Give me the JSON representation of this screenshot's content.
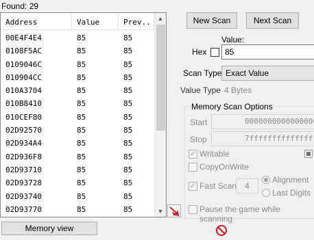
{
  "found": {
    "label": "Found: 29"
  },
  "list": {
    "columns": [
      "Address",
      "Value",
      "Prev.."
    ],
    "rows": [
      {
        "address": "00E4F4E4",
        "value": "85",
        "prev": "85"
      },
      {
        "address": "0108F5AC",
        "value": "85",
        "prev": "85"
      },
      {
        "address": "0109046C",
        "value": "85",
        "prev": "85"
      },
      {
        "address": "010904CC",
        "value": "85",
        "prev": "85"
      },
      {
        "address": "010A3704",
        "value": "85",
        "prev": "85"
      },
      {
        "address": "010B8410",
        "value": "85",
        "prev": "85"
      },
      {
        "address": "010CEF80",
        "value": "85",
        "prev": "85"
      },
      {
        "address": "02D92570",
        "value": "85",
        "prev": "85"
      },
      {
        "address": "02D934A4",
        "value": "85",
        "prev": "85"
      },
      {
        "address": "02D936F8",
        "value": "85",
        "prev": "85"
      },
      {
        "address": "02D93710",
        "value": "85",
        "prev": "85"
      },
      {
        "address": "02D93728",
        "value": "85",
        "prev": "85"
      },
      {
        "address": "02D93740",
        "value": "85",
        "prev": "85"
      },
      {
        "address": "02D93770",
        "value": "85",
        "prev": "85"
      }
    ]
  },
  "buttons": {
    "new_scan": "New Scan",
    "next_scan": "Next Scan",
    "memory_view": "Memory view"
  },
  "value": {
    "label": "Value:",
    "hex_label": "Hex",
    "current": "85"
  },
  "scan_type": {
    "label": "Scan Type",
    "selected": "Exact Value"
  },
  "value_type": {
    "label": "Value Type",
    "selected": "4 Bytes"
  },
  "memory_scan_options": {
    "title": "Memory Scan Options",
    "start_label": "Start",
    "start_value": "0000000000000000",
    "stop_label": "Stop",
    "stop_value": "7fffffffffffffff",
    "writable": "Writable",
    "copy_on_write": "CopyOnWrite",
    "fast_scan": "Fast Scan",
    "fast_scan_value": "4",
    "alignment": "Alignment",
    "last_digits": "Last Digits",
    "pause_game": "Pause the game while scanning"
  },
  "colors": {
    "stop_icon": "#d0191d",
    "pointer_arrow": "#c62020"
  }
}
